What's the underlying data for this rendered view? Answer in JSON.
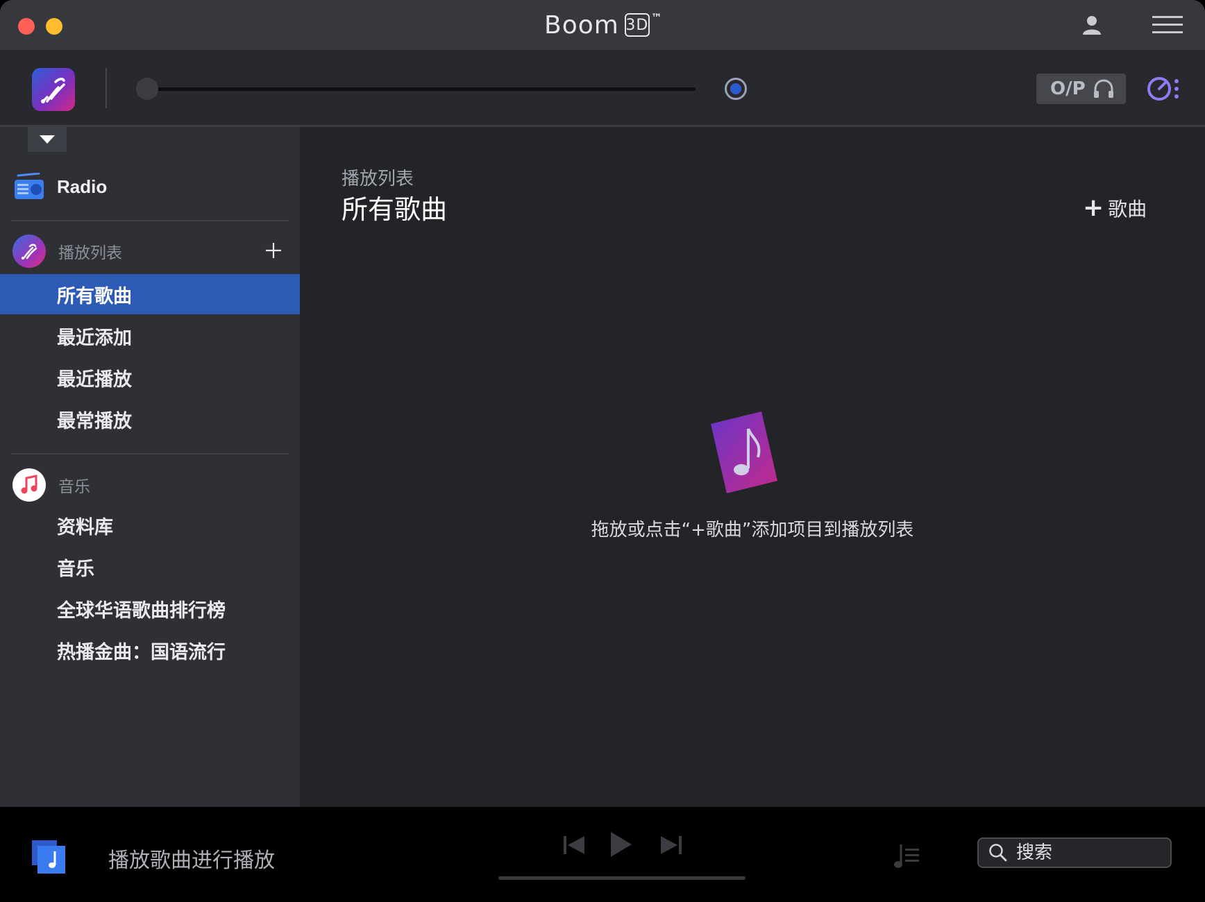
{
  "window": {
    "title_text": "Boom",
    "title_badge": "3D",
    "title_mark": "™"
  },
  "toolbar": {
    "output_label": "O/P",
    "volume_level": 0.0
  },
  "sidebar": {
    "radio_label": "Radio",
    "playlists_header": "播放列表",
    "playlists": [
      {
        "label": "所有歌曲",
        "active": true
      },
      {
        "label": "最近添加",
        "active": false
      },
      {
        "label": "最近播放",
        "active": false
      },
      {
        "label": "最常播放",
        "active": false
      }
    ],
    "music_header": "音乐",
    "music_items": [
      {
        "label": "资料库"
      },
      {
        "label": "音乐"
      },
      {
        "label": "全球华语歌曲排行榜"
      },
      {
        "label": "热播金曲：国语流行"
      }
    ]
  },
  "main": {
    "breadcrumb": "播放列表",
    "title": "所有歌曲",
    "add_song_plus": "+",
    "add_song_label": "歌曲",
    "empty_message": "拖放或点击“+歌曲”添加项目到播放列表"
  },
  "player": {
    "now_playing": "播放歌曲进行播放",
    "search_placeholder": "搜索"
  },
  "colors": {
    "accent": "#2c5ab4",
    "sidebar_bg": "#2f3036",
    "main_bg": "#232428",
    "titlebar_bg": "#36383e"
  }
}
